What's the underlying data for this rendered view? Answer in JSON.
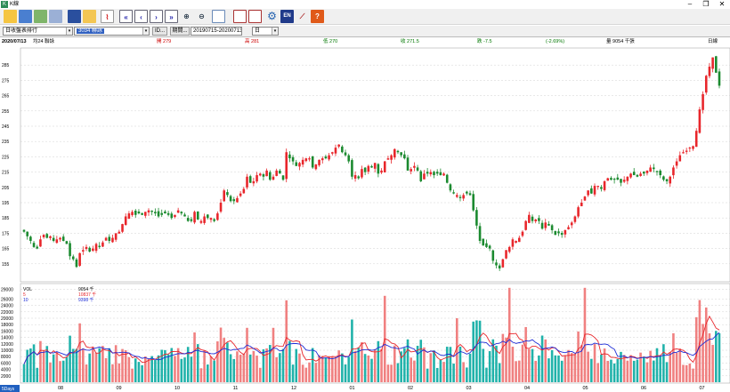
{
  "app": {
    "title": "K線",
    "icon": "K"
  },
  "window_controls": {
    "minimize": "–",
    "maximize": "❐",
    "close": "✕"
  },
  "toolbar": {
    "icons": [
      "folder-icon",
      "save-icon",
      "copy-icon",
      "layers-icon",
      "monitor-icon",
      "clipboard-icon",
      "chart-line-icon",
      "first-page-icon",
      "prev-icon",
      "next-icon",
      "last-page-icon",
      "zoom-in-icon",
      "zoom-out-icon",
      "table-icon",
      "calendar-icon",
      "window-icon",
      "settings-icon",
      "lang-icon",
      "chart-indicator-icon",
      "help-icon"
    ],
    "lang_label": "EN",
    "help_label": "?"
  },
  "selectors": {
    "report": "日收盤表排行",
    "stock_code": "3034",
    "stock_name": "聯詠",
    "id_button": "ID...",
    "period_button": "期間...",
    "date_range": "20190715-20200713",
    "freq": "日"
  },
  "info": {
    "date": "2020/07/13",
    "weekday": "",
    "label": "均24 聯詠",
    "open": "開 279",
    "high": "高 281",
    "low": "低 270",
    "close": "收 271.5",
    "change": "跌 -7.5",
    "pct": "(-2.69%)",
    "volume": "量 9054 千張",
    "freq_label": "日線"
  },
  "volume_legend": {
    "vol_label": "VOL",
    "vol_value": "9054 千",
    "ma5_label": "5",
    "ma5_value": "10837 千",
    "ma10_label": "10",
    "ma10_value": "9398 千"
  },
  "price_axis": [
    "285",
    "275",
    "265",
    "255",
    "245",
    "235",
    "225",
    "215",
    "205",
    "195",
    "185",
    "175",
    "165",
    "155"
  ],
  "volume_axis": [
    "29000",
    "26000",
    "24000",
    "22000",
    "20000",
    "18000",
    "16000",
    "14000",
    "12000",
    "10000",
    "8000",
    "6000",
    "4000",
    "2000"
  ],
  "x_axis": [
    "08",
    "09",
    "10",
    "11",
    "12",
    "01",
    "02",
    "03",
    "04",
    "05",
    "06",
    "07"
  ],
  "corner_label": "5Days",
  "colors": {
    "up": "#e8262b",
    "down": "#1b8a2f",
    "vol_up": "#f08080",
    "vol_down": "#20b2aa",
    "ma5": "#e8262b",
    "ma10": "#1c2bd6",
    "grid": "#c8c8c8"
  },
  "chart_data": {
    "type": "candlestick",
    "period": "2019-07-15 to 2020-07-13",
    "price_range": [
      145,
      295
    ],
    "volume_range": [
      0,
      30000
    ],
    "closes": [
      176,
      173,
      170,
      166,
      165,
      171,
      174,
      172,
      173,
      170,
      171,
      172,
      170,
      168,
      160,
      158,
      153,
      162,
      164,
      166,
      163,
      165,
      168,
      166,
      169,
      172,
      170,
      172,
      175,
      176,
      181,
      186,
      188,
      189,
      187,
      188,
      187,
      189,
      190,
      189,
      188,
      186,
      187,
      188,
      187,
      185,
      187,
      190,
      188,
      186,
      183,
      183,
      189,
      184,
      183,
      186,
      185,
      185,
      183,
      188,
      195,
      203,
      200,
      196,
      196,
      198,
      201,
      204,
      212,
      208,
      209,
      213,
      214,
      212,
      216,
      210,
      212,
      216,
      214,
      210,
      228,
      224,
      222,
      219,
      221,
      223,
      224,
      224,
      218,
      220,
      223,
      224,
      224,
      226,
      228,
      231,
      233,
      228,
      226,
      222,
      212,
      213,
      211,
      217,
      215,
      219,
      218,
      221,
      214,
      216,
      222,
      224,
      226,
      230,
      228,
      226,
      224,
      216,
      217,
      219,
      216,
      209,
      214,
      214,
      215,
      213,
      214,
      213,
      214,
      208,
      203,
      201,
      200,
      198,
      200,
      201,
      200,
      190,
      180,
      170,
      167,
      166,
      165,
      157,
      154,
      152,
      158,
      164,
      166,
      171,
      170,
      172,
      176,
      183,
      187,
      183,
      184,
      183,
      178,
      182,
      180,
      177,
      174,
      175,
      174,
      177,
      179,
      182,
      186,
      192,
      195,
      199,
      203,
      201,
      206,
      206,
      204,
      209,
      211,
      210,
      210,
      210,
      208,
      210,
      212,
      214,
      213,
      212,
      214,
      214,
      216,
      218,
      217,
      215,
      213,
      210,
      209,
      212,
      218,
      222,
      226,
      228,
      229,
      231,
      232,
      242,
      256,
      266,
      278,
      284,
      290,
      280,
      271.5
    ],
    "ylabel": "",
    "xlabel": ""
  }
}
